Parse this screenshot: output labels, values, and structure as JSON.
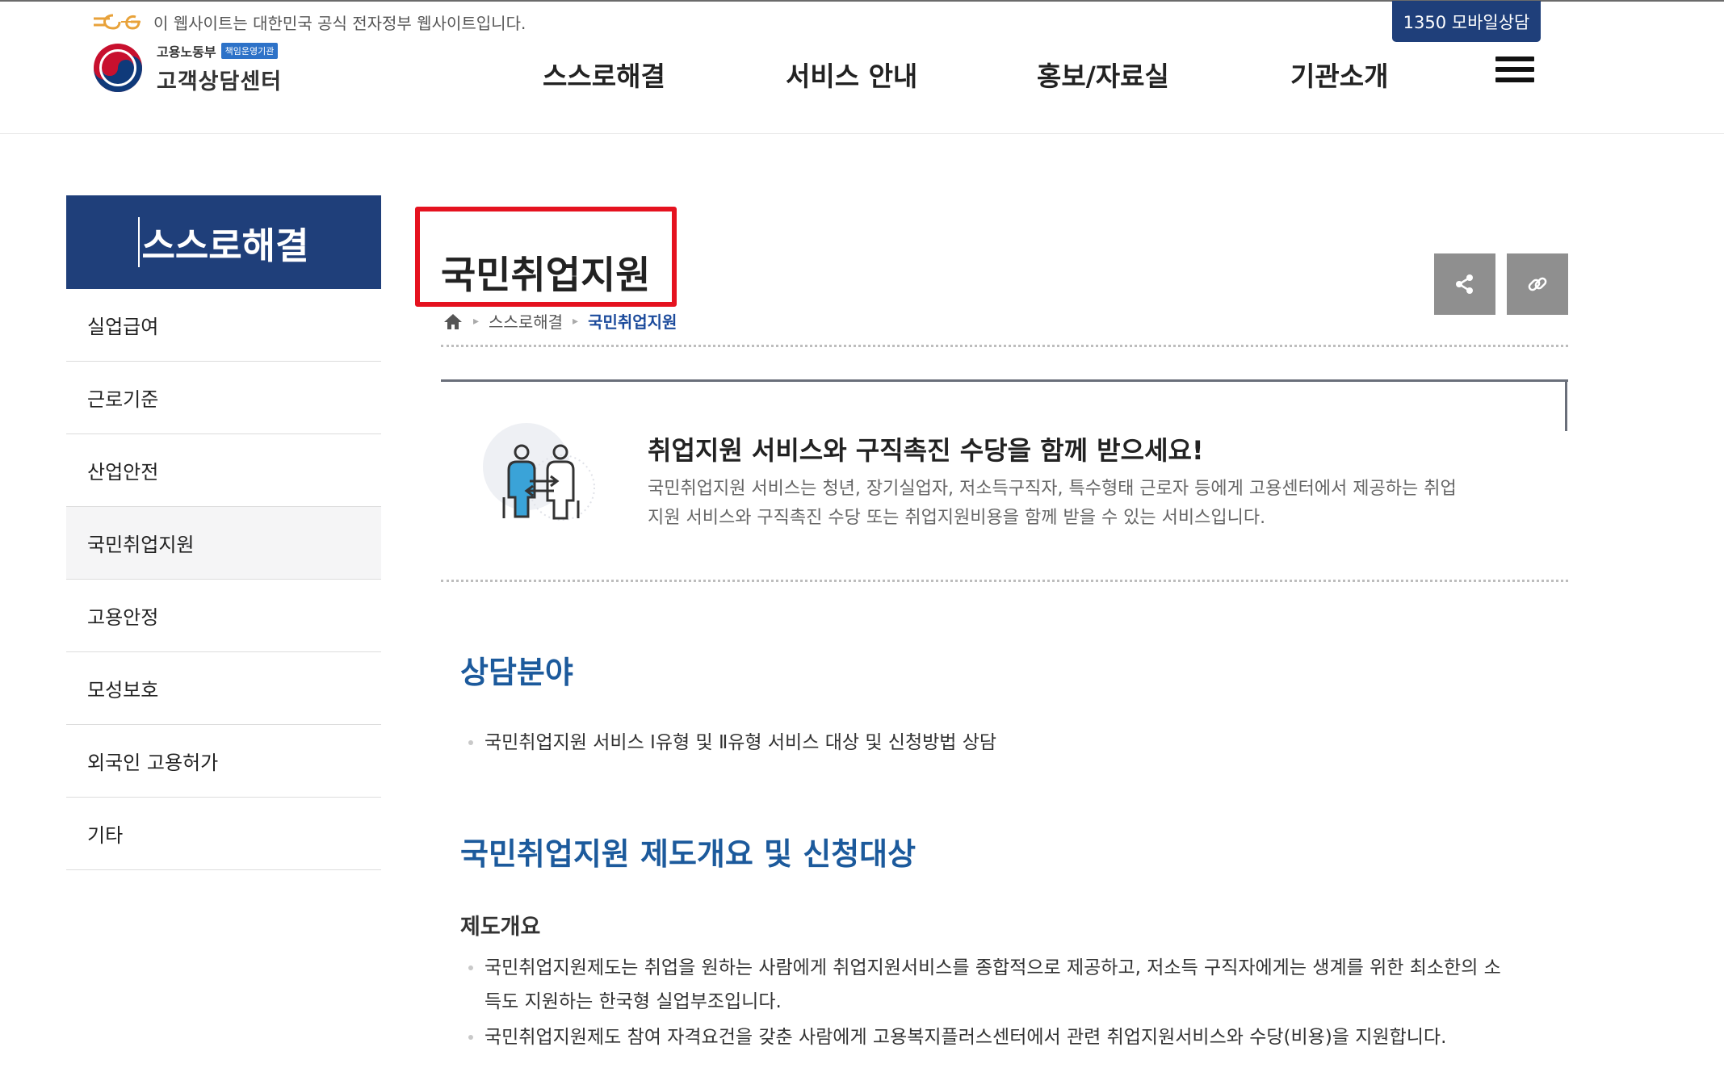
{
  "header": {
    "gov_notice": "이 웹사이트는 대한민국 공식 전자정부 웹사이트입니다.",
    "mobile_button": "1350 모바일상담",
    "logo_ministry": "고용노동부",
    "logo_badge": "책임운영기관",
    "logo_center": "고객상담센터",
    "nav": [
      "스스로해결",
      "서비스 안내",
      "홍보/자료실",
      "기관소개"
    ],
    "menu_icon": "hamburger-icon"
  },
  "sidebar": {
    "title": "스스로해결",
    "items": [
      {
        "label": "실업급여"
      },
      {
        "label": "근로기준"
      },
      {
        "label": "산업안전"
      },
      {
        "label": "국민취업지원"
      },
      {
        "label": "고용안정"
      },
      {
        "label": "모성보호"
      },
      {
        "label": "외국인 고용허가"
      },
      {
        "label": "기타"
      }
    ],
    "active_item": "국민취업지원"
  },
  "main": {
    "page_title": "국민취업지원",
    "share_icon": "share-icon",
    "link_icon": "link-icon",
    "breadcrumb": {
      "home_icon": "home-icon",
      "level1": "스스로해결",
      "current": "국민취업지원"
    },
    "intro": {
      "headline": "취업지원 서비스와 구직촉진 수당을 함께 받으세요!",
      "desc_line1": "국민취업지원 서비스는 청년, 장기실업자, 저소득구직자, 특수형태 근로자 등에게 고용센터에서 제공하는 취업",
      "desc_line2": "지원 서비스와 구직촉진 수당 또는 취업지원비용을 함께 받을 수 있는 서비스입니다."
    },
    "consult": {
      "title": "상담분야",
      "item": "국민취업지원 서비스 Ⅰ유형 및 Ⅱ유형 서비스 대상 및 신청방법 상담"
    },
    "overview": {
      "title": "국민취업지원 제도개요 및 신청대상",
      "subtitle": "제도개요",
      "item1_line1": "국민취업지원제도는 취업을 원하는 사람에게 취업지원서비스를 종합적으로 제공하고, 저소득 구직자에게는 생계를 위한 최소한의 소",
      "item1_line2": "득도 지원하는 한국형 실업부조입니다.",
      "item2": "국민취업지원제도 참여 자격요건을 갖춘 사람에게 고용복지플러스센터에서 관련 취업지원서비스와 수당(비용)을 지원합니다."
    }
  },
  "colors": {
    "primary_navy": "#1f3f7a",
    "section_blue": "#1c5a9c",
    "highlight_red": "#e5121f",
    "icon_button_gray": "#8f8f8f"
  }
}
